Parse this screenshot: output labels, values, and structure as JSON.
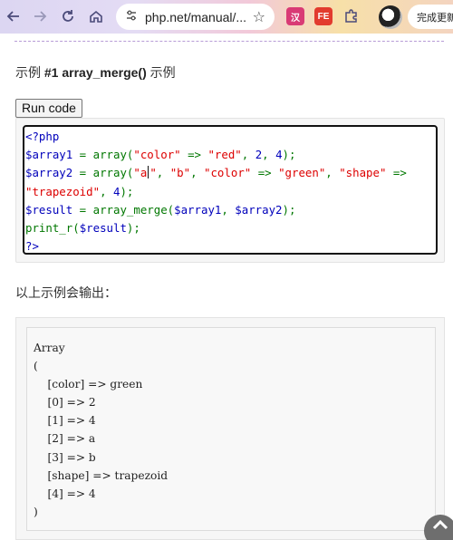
{
  "browser": {
    "url": "php.net/manual/...",
    "finish_button_label": "完成更新",
    "icons": [
      "back-icon",
      "forward-icon",
      "reload-icon",
      "home-icon",
      "site-info-icon",
      "bookmark-star-icon",
      "extension-icons",
      "profile-avatar"
    ]
  },
  "page": {
    "example_title_prefix": "示例 ",
    "example_title_bold": "#1 array_merge()",
    "example_title_suffix": " 示例",
    "run_button_label": "Run code",
    "output_heading": "以上示例会输出："
  },
  "code_lines": [
    [
      {
        "t": "<?php",
        "c": "tag"
      }
    ],
    [
      {
        "t": "$array1",
        "c": "var"
      },
      {
        "t": " = ",
        "c": "fn"
      },
      {
        "t": "array",
        "c": "fn"
      },
      {
        "t": "(",
        "c": "fn"
      },
      {
        "t": "\"color\"",
        "c": "str"
      },
      {
        "t": " => ",
        "c": "fn"
      },
      {
        "t": "\"red\"",
        "c": "str"
      },
      {
        "t": ", ",
        "c": "fn"
      },
      {
        "t": "2",
        "c": "num"
      },
      {
        "t": ", ",
        "c": "fn"
      },
      {
        "t": "4",
        "c": "num"
      },
      {
        "t": ");",
        "c": "fn"
      }
    ],
    [
      {
        "t": "$array2",
        "c": "var"
      },
      {
        "t": " = ",
        "c": "fn"
      },
      {
        "t": "array",
        "c": "fn"
      },
      {
        "t": "(",
        "c": "fn"
      },
      {
        "t": "\"a",
        "c": "str"
      },
      {
        "t": "|",
        "c": "cursor"
      },
      {
        "t": "\"",
        "c": "str"
      },
      {
        "t": ", ",
        "c": "fn"
      },
      {
        "t": "\"b\"",
        "c": "str"
      },
      {
        "t": ", ",
        "c": "fn"
      },
      {
        "t": "\"color\"",
        "c": "str"
      },
      {
        "t": " => ",
        "c": "fn"
      },
      {
        "t": "\"green\"",
        "c": "str"
      },
      {
        "t": ", ",
        "c": "fn"
      },
      {
        "t": "\"shape\"",
        "c": "str"
      },
      {
        "t": " =>",
        "c": "fn"
      }
    ],
    [
      {
        "t": "\"trapezoid\"",
        "c": "str"
      },
      {
        "t": ", ",
        "c": "fn"
      },
      {
        "t": "4",
        "c": "num"
      },
      {
        "t": ");",
        "c": "fn"
      }
    ],
    [
      {
        "t": "$result",
        "c": "var"
      },
      {
        "t": " = ",
        "c": "fn"
      },
      {
        "t": "array_merge",
        "c": "fn"
      },
      {
        "t": "(",
        "c": "fn"
      },
      {
        "t": "$array1",
        "c": "var"
      },
      {
        "t": ", ",
        "c": "fn"
      },
      {
        "t": "$array2",
        "c": "var"
      },
      {
        "t": ");",
        "c": "fn"
      }
    ],
    [
      {
        "t": "print_r",
        "c": "fn"
      },
      {
        "t": "(",
        "c": "fn"
      },
      {
        "t": "$result",
        "c": "var"
      },
      {
        "t": ");",
        "c": "fn"
      }
    ],
    [
      {
        "t": "?>",
        "c": "tag"
      }
    ]
  ],
  "output_lines": [
    "Array",
    "(",
    "    [color] => green",
    "    [0] => 2",
    "    [1] => 4",
    "    [2] => a",
    "    [3] => b",
    "    [shape] => trapezoid",
    "    [4] => 4",
    ")"
  ],
  "colors": {
    "code_tag": "#0000bb",
    "code_keyword": "#007700",
    "code_string": "#dd0000"
  }
}
